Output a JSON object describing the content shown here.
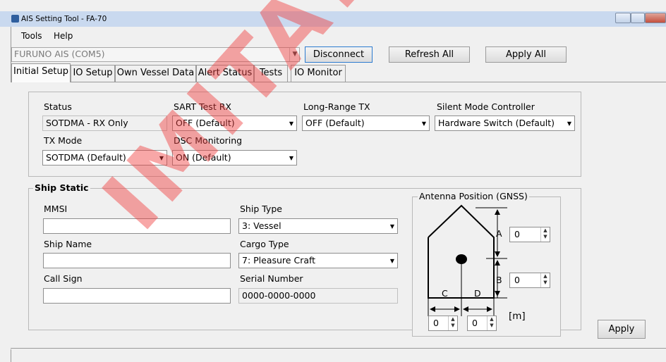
{
  "window": {
    "title": "AIS Setting Tool - FA-70"
  },
  "menu": {
    "items": [
      "Tools",
      "Help"
    ]
  },
  "toolbar": {
    "port": "FURUNO AIS (COM5)",
    "disconnect_label": "Disconnect",
    "refresh_label": "Refresh All",
    "apply_all_label": "Apply All"
  },
  "tabs": [
    "Initial Setup",
    "IO Setup",
    "Own Vessel Data",
    "Alert Status",
    "Tests",
    "IO Monitor"
  ],
  "initial": {
    "status_label": "Status",
    "status_value": "SOTDMA - RX Only",
    "sart_label": "SART Test RX",
    "sart_value": "OFF (Default)",
    "longrange_label": "Long-Range TX",
    "longrange_value": "OFF (Default)",
    "silent_label": "Silent Mode Controller",
    "silent_value": "Hardware Switch (Default)",
    "txmode_label": "TX Mode",
    "txmode_value": "SOTDMA (Default)",
    "dsc_label": "DSC Monitoring",
    "dsc_value": "ON (Default)"
  },
  "ship_static": {
    "title": "Ship Static",
    "mmsi_label": "MMSI",
    "mmsi_value": "",
    "name_label": "Ship Name",
    "name_value": "",
    "callsign_label": "Call Sign",
    "callsign_value": "",
    "type_label": "Ship Type",
    "type_value": "3: Vessel",
    "cargo_label": "Cargo Type",
    "cargo_value": "7: Pleasure Craft",
    "serial_label": "Serial Number",
    "serial_value": "0000-0000-0000"
  },
  "antenna": {
    "title": "Antenna Position (GNSS)",
    "a_label": "A",
    "b_label": "B",
    "c_label": "C",
    "d_label": "D",
    "a_value": "0",
    "b_value": "0",
    "c_value": "0",
    "d_value": "0",
    "unit": "[m]"
  },
  "apply_label": "Apply",
  "watermark": "IMITATIVE"
}
